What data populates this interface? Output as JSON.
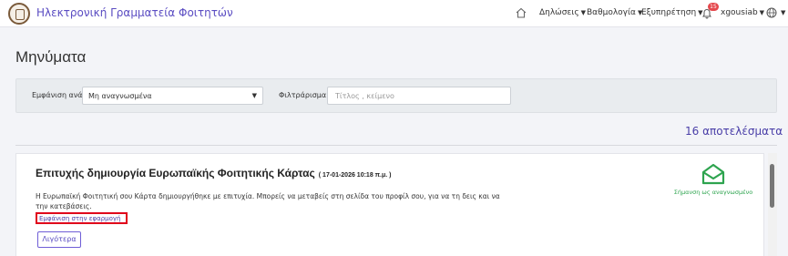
{
  "header": {
    "app_title": "Ηλεκτρονική Γραμματεία Φοιτητών",
    "nav": {
      "declarations": "Δηλώσεις",
      "grades": "Βαθμολογία",
      "service": "Εξυπηρέτηση",
      "notifications_count": "15",
      "username": "xgousiab"
    },
    "icons": [
      "university-logo",
      "home-icon",
      "bell-icon",
      "globe-icon",
      "chevron-down-icon"
    ]
  },
  "page": {
    "title": "Μηνύματα"
  },
  "filters": {
    "show_by_label": "Εμφάνιση ανά",
    "show_by_value": "Μη αναγνωσμένα",
    "filter_label": "Φιλτράρισμα",
    "filter_placeholder": "Τίτλος , κείμενο"
  },
  "results": {
    "count_text": "16 αποτελέσματα"
  },
  "message": {
    "title": "Επιτυχής δημιουργία Ευρωπαϊκής Φοιτητικής Κάρτας",
    "date": "( 17-01-2026 10:18 π.μ. )",
    "body": "Η Ευρωπαϊκή Φοιτητική σου Κάρτα δημιουργήθηκε με επιτυχία. Μπορείς να μεταβείς στη σελίδα του προφίλ σου, για να τη δεις και να την κατεβάσεις.",
    "app_link": "Εμφάνιση στην εφαρμογή",
    "more_button": "Λιγότερα",
    "mark_read_label": "Σήμανση ως αναγνωσμένο"
  },
  "colors": {
    "accent": "#5a4cc2",
    "mark_read": "#2ea44f",
    "highlight_box": "#e0001b",
    "badge": "#e5484d"
  }
}
